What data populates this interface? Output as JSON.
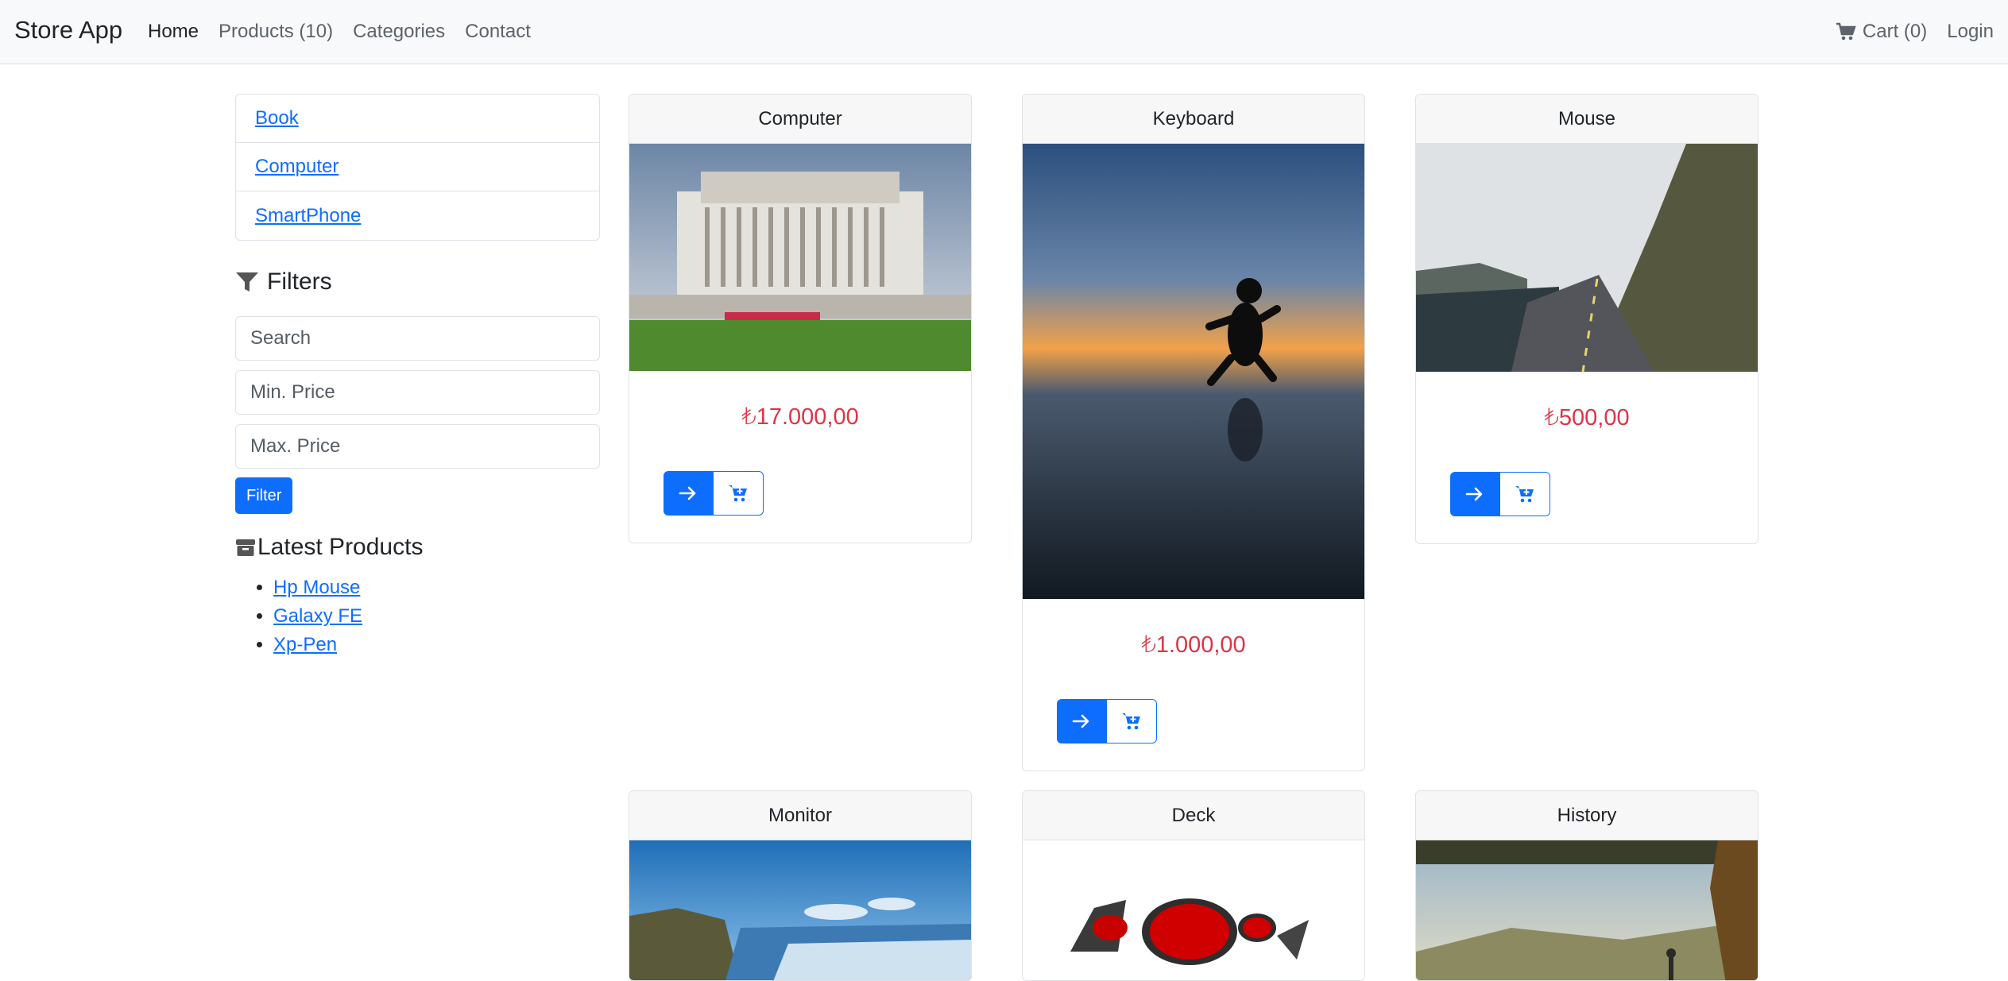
{
  "navbar": {
    "brand": "Store App",
    "links": [
      "Home",
      "Products (10)",
      "Categories",
      "Contact"
    ],
    "cart_label": "Cart (0)",
    "login_label": "Login"
  },
  "sidebar": {
    "categories": [
      "Book",
      "Computer",
      "SmartPhone"
    ],
    "filters_title": "Filters",
    "search_placeholder": "Search",
    "min_price_placeholder": "Min. Price",
    "max_price_placeholder": "Max. Price",
    "filter_button": "Filter",
    "latest_title": "Latest Products",
    "latest_products": [
      "Hp Mouse",
      "Galaxy FE",
      "Xp-Pen"
    ]
  },
  "products": [
    {
      "title": "Computer",
      "price": "₺17.000,00"
    },
    {
      "title": "Keyboard",
      "price": "₺1.000,00"
    },
    {
      "title": "Mouse",
      "price": "₺500,00"
    },
    {
      "title": "Monitor",
      "price": ""
    },
    {
      "title": "Deck",
      "price": ""
    },
    {
      "title": "History",
      "price": ""
    }
  ],
  "colors": {
    "primary": "#0d6efd",
    "price": "#dc3545",
    "navbar_bg": "#f8f9fa"
  }
}
